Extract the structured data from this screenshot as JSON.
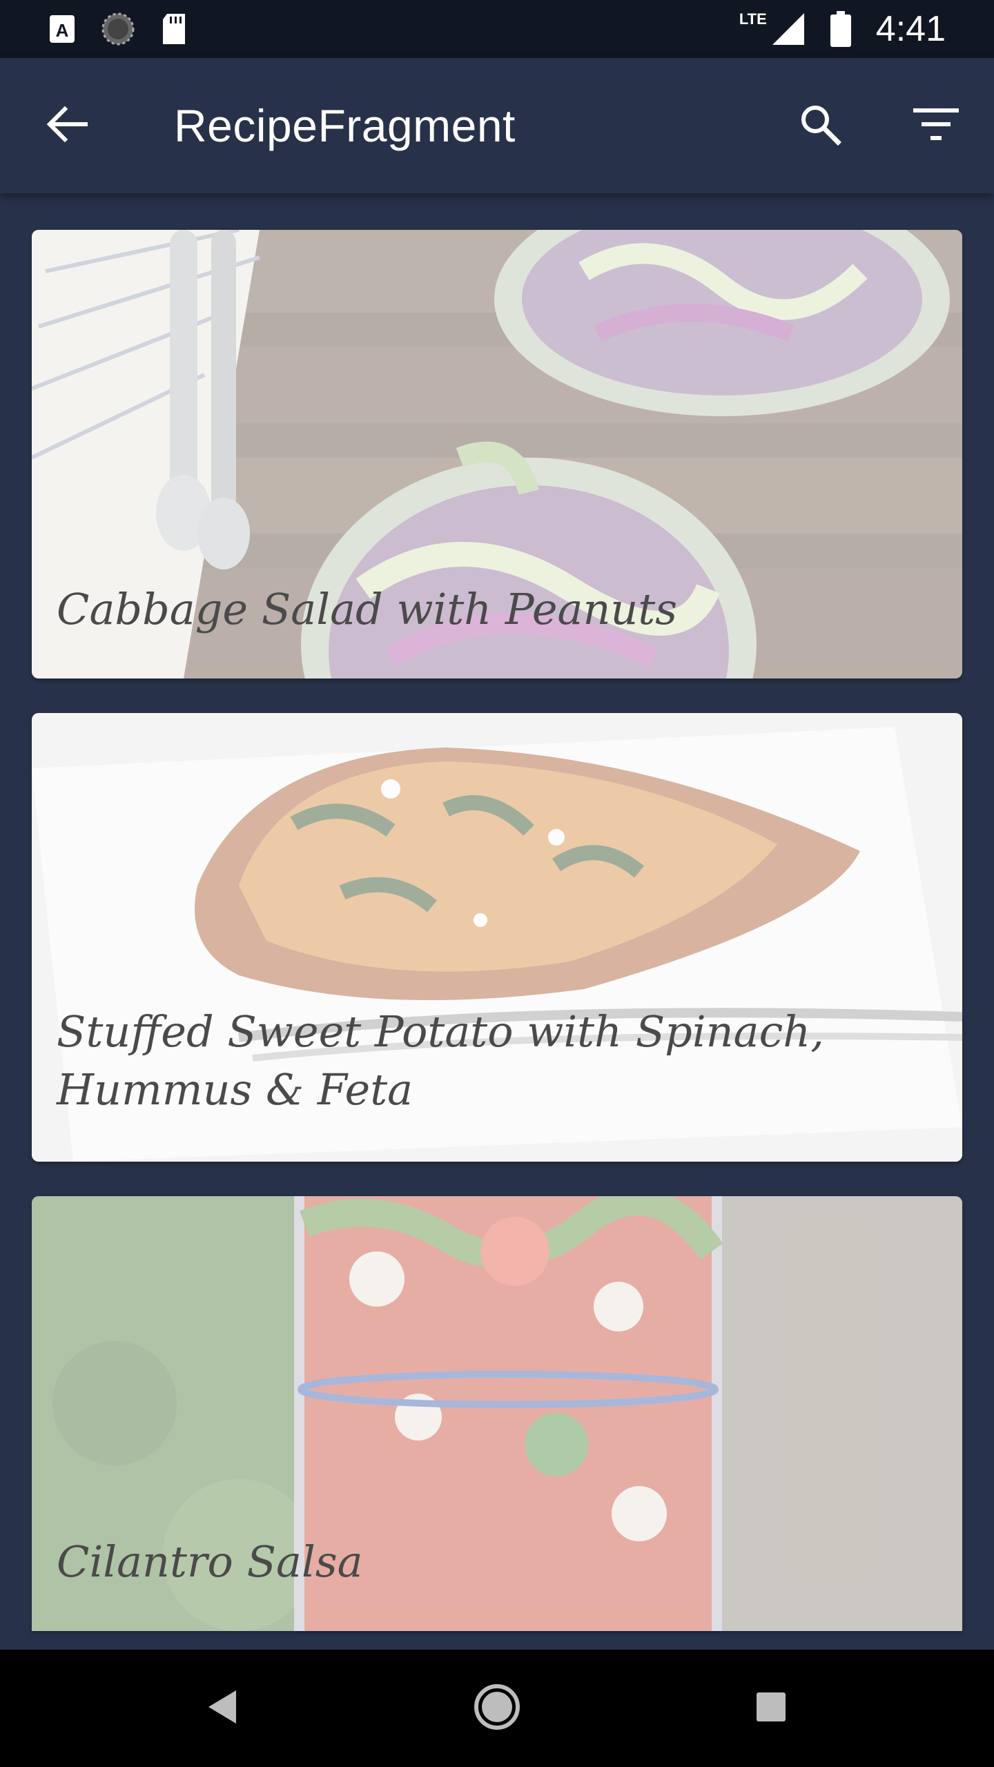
{
  "status_bar": {
    "time": "4:41",
    "network": "LTE",
    "icons": [
      "keyboard-a-icon",
      "sync-circle-icon",
      "sd-card-icon",
      "signal-icon",
      "battery-icon"
    ]
  },
  "app_bar": {
    "title": "RecipeFragment",
    "icons": [
      "back-arrow-icon",
      "search-icon",
      "filter-icon"
    ]
  },
  "recipes": [
    {
      "title": "Cabbage Salad with Peanuts",
      "palette": [
        "#6b5a4c",
        "#a383b6",
        "#d6dcb0"
      ]
    },
    {
      "title": "Stuffed Sweet Potato with Spinach, Hummus & Feta",
      "palette": [
        "#f2f2f2",
        "#d38a3e",
        "#3d5a2a"
      ]
    },
    {
      "title": "Cilantro Salsa",
      "palette": [
        "#4f7a3a",
        "#d04a3a",
        "#8fa0c8"
      ]
    }
  ],
  "nav_bar": {
    "icons": [
      "nav-back-icon",
      "nav-home-icon",
      "nav-recents-icon"
    ]
  },
  "colors": {
    "app_bar_bg": "#27324a",
    "status_bar_bg": "#111722",
    "title_text": "#ffffff",
    "card_title_text": "#4a4a4a"
  }
}
